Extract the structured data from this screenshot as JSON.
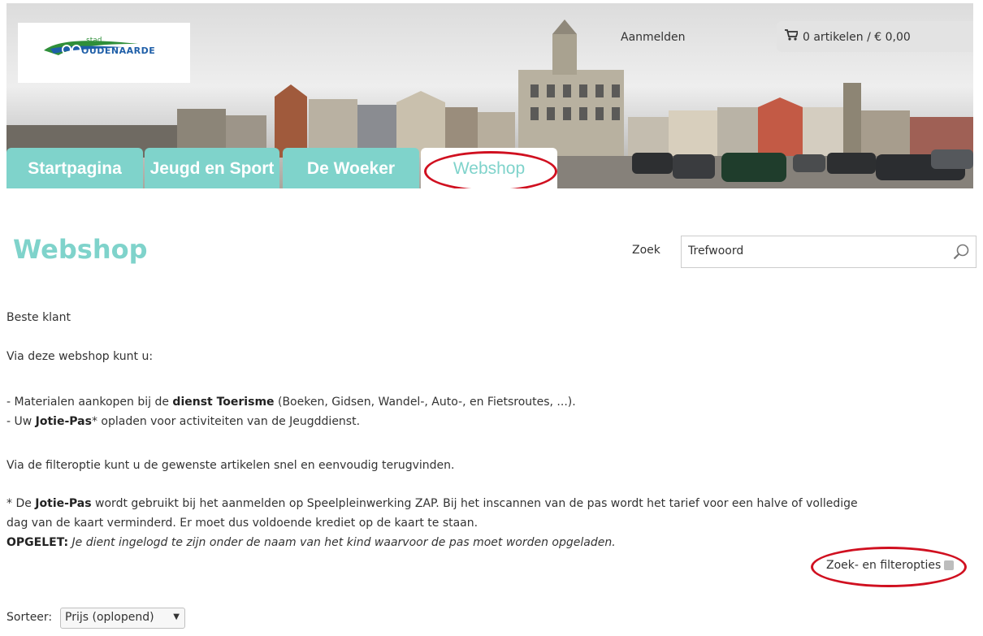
{
  "header": {
    "logo": {
      "small": "stad",
      "name": "OUDENAARDE"
    },
    "login_label": "Aanmelden",
    "cart_label": "0 artikelen / € 0,00",
    "icons": {
      "cart": "cart-icon",
      "search": "search-icon",
      "chevron": "chevron-down-icon"
    }
  },
  "nav": {
    "tabs": [
      {
        "label": "Startpagina"
      },
      {
        "label": "Jeugd en Sport"
      },
      {
        "label": "De Woeker"
      },
      {
        "label": "Webshop",
        "active": true
      }
    ]
  },
  "main": {
    "title": "Webshop",
    "search": {
      "label": "Zoek",
      "value": "Trefwoord"
    },
    "intro": {
      "greeting": "Beste klant",
      "lead": "Via deze webshop kunt u:",
      "item1_prefix": "- Materialen aankopen bij de ",
      "item1_bold": "dienst Toerisme",
      "item1_suffix": " (Boeken, Gidsen, Wandel-, Auto-, en Fietsroutes, ...).",
      "item2_prefix": "- Uw ",
      "item2_bold": "Jotie-Pas",
      "item2_suffix": "* opladen voor activiteiten van de Jeugddienst.",
      "filter_note": "Via de filteroptie kunt u de gewenste artikelen snel en eenvoudig terugvinden.",
      "note_prefix": "* De ",
      "note_bold": "Jotie-Pas",
      "note_line1": " wordt gebruikt bij het aanmelden op Speelpleinwerking ZAP. Bij het inscannen van de pas wordt het tarief voor een halve of volledige",
      "note_line2": "dag van de kaart verminderd. Er moet dus voldoende krediet op de kaart te staan.",
      "warning_label": "OPGELET:",
      "warning_text": " Je dient ingelogd te zijn onder de naam van het kind waarvoor de pas moet worden opgeladen."
    },
    "filter_link": "Zoek- en filteropties",
    "sort": {
      "label": "Sorteer:",
      "selected": "Prijs (oplopend)"
    }
  },
  "colors": {
    "accent": "#7fd3cb",
    "annotation": "#d01020",
    "logo_blue": "#1f5fa8",
    "logo_green": "#2f8f3a"
  }
}
